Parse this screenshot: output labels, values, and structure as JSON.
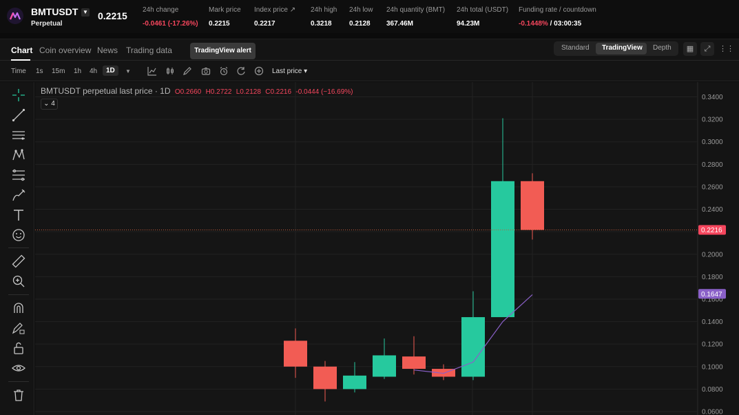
{
  "header": {
    "symbol": "BMTUSDT",
    "contract_type": "Perpetual",
    "last_price": "0.2215",
    "stats": [
      {
        "label": "24h change",
        "value": "-0.0461 (-17.26%)",
        "color": "red"
      },
      {
        "label": "Mark price",
        "value": "0.2215",
        "color": "white"
      },
      {
        "label": "Index price",
        "value": "0.2217",
        "color": "white"
      },
      {
        "label": "24h high",
        "value": "0.3218",
        "color": "white"
      },
      {
        "label": "24h low",
        "value": "0.2128",
        "color": "white"
      },
      {
        "label": "24h quantity (BMT)",
        "value": "367.46M",
        "color": "white"
      },
      {
        "label": "24h total (USDT)",
        "value": "94.23M",
        "color": "white"
      },
      {
        "label": "Funding rate / countdown",
        "value_rate": "-0.1448%",
        "value_countdown": "/ 03:00:35",
        "color": "red"
      }
    ]
  },
  "tabs": {
    "items": [
      "Chart",
      "Coin overview",
      "News",
      "Trading data"
    ],
    "active": "Chart",
    "tooltip": "TradingView alert",
    "views": [
      "Standard",
      "TradingView",
      "Depth"
    ],
    "active_view": "TradingView"
  },
  "toolbar": {
    "time_label": "Time",
    "intervals": [
      "1s",
      "15m",
      "1h",
      "4h",
      "1D"
    ],
    "active_interval": "1D",
    "price_type": "Last price ▾",
    "icons": [
      "indicator-icon",
      "candle-type-icon",
      "draw-icon",
      "camera-icon",
      "alarm-icon",
      "replay-icon",
      "add-icon"
    ]
  },
  "left_tools": [
    "crosshair-icon",
    "trend-line-icon",
    "horizontal-lines-icon",
    "pattern-icon",
    "fib-icon",
    "brush-icon",
    "text-icon",
    "emoji-icon",
    "ruler-icon",
    "zoom-in-icon",
    "magnet-icon",
    "lock-draw-icon",
    "unlock-icon",
    "eye-icon",
    "trash-icon"
  ],
  "chart_data": {
    "type": "candlestick",
    "legend_title": "BMTUSDT perpetual last price · 1D",
    "legend_ohlc": {
      "open": "O0.2660",
      "high": "H0.2722",
      "low": "L0.2128",
      "close": "C0.2216",
      "change": "-0.0444 (−16.69%)"
    },
    "indicator_count": "4",
    "y_ticks": [
      "0.3400",
      "0.3200",
      "0.3000",
      "0.2800",
      "0.2600",
      "0.2400",
      "0.2200",
      "0.2000",
      "0.1800",
      "0.1600",
      "0.1400",
      "0.1200",
      "0.1000",
      "0.0800",
      "0.0600"
    ],
    "ylim": [
      0.06,
      0.34
    ],
    "candles": [
      {
        "o": 0.123,
        "h": 0.134,
        "l": 0.09,
        "c": 0.1
      },
      {
        "o": 0.1,
        "h": 0.105,
        "l": 0.069,
        "c": 0.08
      },
      {
        "o": 0.08,
        "h": 0.104,
        "l": 0.077,
        "c": 0.092
      },
      {
        "o": 0.091,
        "h": 0.125,
        "l": 0.089,
        "c": 0.11
      },
      {
        "o": 0.109,
        "h": 0.127,
        "l": 0.093,
        "c": 0.098
      },
      {
        "o": 0.098,
        "h": 0.102,
        "l": 0.088,
        "c": 0.091
      },
      {
        "o": 0.091,
        "h": 0.167,
        "l": 0.088,
        "c": 0.144
      },
      {
        "o": 0.144,
        "h": 0.321,
        "l": 0.144,
        "c": 0.265
      },
      {
        "o": 0.265,
        "h": 0.272,
        "l": 0.213,
        "c": 0.2216
      }
    ],
    "ma_line": [
      null,
      null,
      null,
      null,
      0.097,
      0.094,
      0.104,
      0.14,
      0.164
    ],
    "current_price_label": "0.2216",
    "current_price": 0.2216,
    "ma_label": "0.1647",
    "ma_value": 0.1647,
    "colors": {
      "up": "#26c99e",
      "down": "#f25c54",
      "ma": "#8a60c8",
      "price_tag": "#f6465d",
      "ma_tag": "#8a60c8"
    },
    "grid": true
  }
}
